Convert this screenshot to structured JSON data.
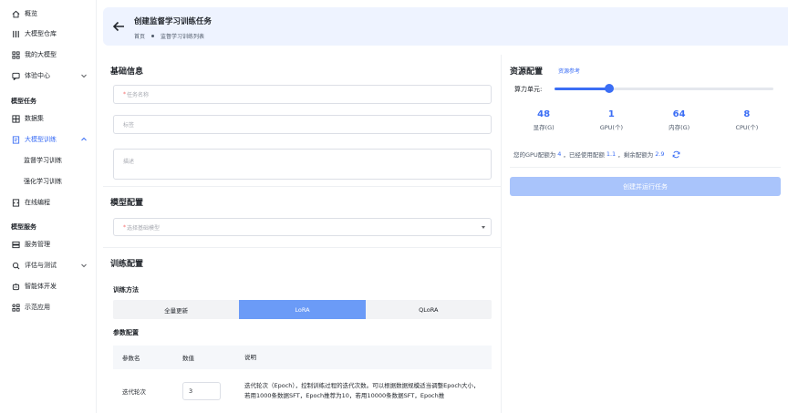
{
  "sidebar": {
    "items": [
      {
        "label": "概览",
        "icon": "home-icon"
      },
      {
        "label": "大模型仓库",
        "icon": "repository-icon"
      },
      {
        "label": "我的大模型",
        "icon": "grid-icon"
      },
      {
        "label": "体验中心",
        "icon": "chat-icon"
      }
    ],
    "section_training": "模型任务",
    "training_items": [
      {
        "label": "数据集",
        "icon": "dataset-icon"
      },
      {
        "label": "大模型训练",
        "icon": "doc-icon"
      },
      {
        "label": "监督学习训练"
      },
      {
        "label": "强化学习训练"
      },
      {
        "label": "在线编程",
        "icon": "code-icon"
      }
    ],
    "section_service": "模型服务",
    "service_items": [
      {
        "label": "服务管理",
        "icon": "server-icon"
      },
      {
        "label": "评估与测试",
        "icon": "evaluate-icon"
      },
      {
        "label": "智能体开发",
        "icon": "agent-icon"
      },
      {
        "label": "示范应用",
        "icon": "app-icon"
      }
    ]
  },
  "header": {
    "title": "创建监督学习训练任务",
    "breadcrumb": [
      "首页",
      "监督学习训练列表"
    ]
  },
  "basic": {
    "title": "基础信息",
    "task_name_placeholder": "任务名称",
    "tags_placeholder": "标签",
    "description_placeholder": "描述"
  },
  "model_config": {
    "title": "模型配置",
    "base_model_placeholder": "选择基础模型"
  },
  "training": {
    "title": "训练配置",
    "method_label": "训练方法",
    "methods": [
      "全量更新",
      "LoRA",
      "QLoRA"
    ],
    "selected_method": "LoRA",
    "params_label": "参数配置",
    "table_headers": [
      "参数名",
      "数值",
      "说明"
    ],
    "rows": [
      {
        "name": "迭代轮次",
        "value": "3",
        "desc": "迭代轮次（Epoch），控制训练过程的迭代次数。可以根据数据规模适当调整Epoch大小，若用1000条数据SFT，Epoch推荐为10，若用10000条数据SFT，Epoch推"
      }
    ]
  },
  "resources": {
    "title": "资源配置",
    "ref_link": "资源参考",
    "slider_label": "算力单元:",
    "slider_fraction": 0.25,
    "stats": [
      {
        "value": "48",
        "label": "显存(G)"
      },
      {
        "value": "1",
        "label": "GPU(个)"
      },
      {
        "value": "64",
        "label": "内存(G)"
      },
      {
        "value": "8",
        "label": "CPU(个)"
      }
    ],
    "quota_prefix": "您的GPU配额为",
    "quota_total": "4",
    "quota_used_prefix": "，已经使用配额",
    "quota_used": "1.1",
    "quota_left_prefix": "，剩余配额为",
    "quota_left": "2.9",
    "run_button": "创建并运行任务"
  },
  "colors": {
    "accent": "#3b6ef5",
    "header_bg": "#eef3ff",
    "disabled_button": "#a9c4fb"
  }
}
